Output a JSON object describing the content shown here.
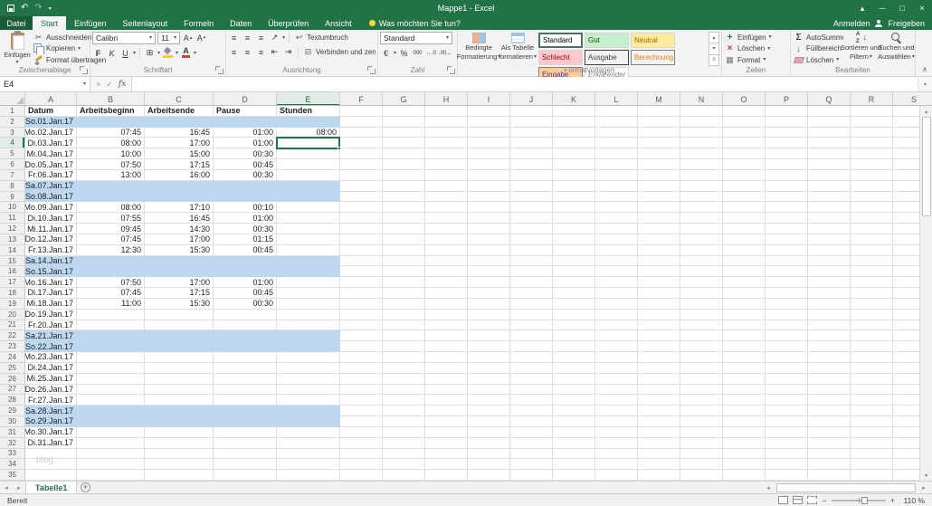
{
  "window": {
    "title": "Mappe1 - Excel",
    "sign_in": "Anmelden",
    "share": "Freigeben"
  },
  "tabs": {
    "file": "Datei",
    "active": "Start",
    "items": [
      "Start",
      "Einfügen",
      "Seitenlayout",
      "Formeln",
      "Daten",
      "Überprüfen",
      "Ansicht"
    ],
    "tell_me": "Was möchten Sie tun?"
  },
  "ribbon": {
    "clipboard": {
      "title": "Zwischenablage",
      "paste": "Einfügen",
      "cut": "Ausschneiden",
      "copy": "Kopieren",
      "format_painter": "Format übertragen"
    },
    "font": {
      "title": "Schriftart",
      "name": "Calibri",
      "size": "11",
      "bold": "F",
      "italic": "K",
      "underline": "U"
    },
    "alignment": {
      "title": "Ausrichtung",
      "wrap": "Textumbruch",
      "merge": "Verbinden und zentrieren"
    },
    "number": {
      "title": "Zahl",
      "format": "Standard"
    },
    "styles": {
      "title": "Formatvorlagen",
      "conditional": [
        "Bedingte",
        "Formatierung"
      ],
      "as_table": [
        "Als Tabelle",
        "formatieren"
      ],
      "gallery": [
        {
          "label": "Standard",
          "bg": "#ffffff",
          "color": "#000000",
          "selected": true
        },
        {
          "label": "Gut",
          "bg": "#c6efce",
          "color": "#006100"
        },
        {
          "label": "Neutral",
          "bg": "#ffeb9c",
          "color": "#9c6500"
        },
        {
          "label": "Schlecht",
          "bg": "#ffc7ce",
          "color": "#9c0006"
        },
        {
          "label": "Ausgabe",
          "bg": "#f2f2f2",
          "color": "#3f3f3f",
          "border": "#3f3f3f"
        },
        {
          "label": "Berechnung",
          "bg": "#f2f2f2",
          "color": "#fa7d00",
          "border": "#7f7f7f"
        },
        {
          "label": "Eingabe",
          "bg": "#ffcc99",
          "color": "#3f3f76",
          "border": "#7f7f7f"
        },
        {
          "label": "Erklärender ...",
          "bg": "#ffffff",
          "color": "#7f7f7f",
          "italic": true
        }
      ]
    },
    "cells": {
      "title": "Zellen",
      "insert": "Einfügen",
      "delete": "Löschen",
      "format": "Format"
    },
    "editing": {
      "title": "Bearbeiten",
      "autosum": "AutoSumme",
      "fill": "Füllbereich",
      "clear": "Löschen",
      "sort": [
        "Sortieren und",
        "Filtern"
      ],
      "find": [
        "Suchen und",
        "Auswählen"
      ]
    }
  },
  "formula_bar": {
    "name_box": "E4",
    "formula": ""
  },
  "sheet": {
    "columns": [
      "A",
      "B",
      "C",
      "D",
      "E",
      "F",
      "G",
      "H",
      "I",
      "J",
      "K",
      "L",
      "M",
      "N",
      "O",
      "P",
      "Q",
      "R",
      "S"
    ],
    "visible_rows": 35,
    "selected": {
      "col": "E",
      "row": 4
    },
    "header_row": [
      "Datum",
      "Arbeitsbeginn",
      "Arbeitsende",
      "Pause",
      "Stunden"
    ],
    "weekend_fill": "#bdd7ee",
    "rows": [
      {
        "n": 2,
        "a": "So.01.Jan.17",
        "we": true
      },
      {
        "n": 3,
        "a": "Mo.02.Jan.17",
        "b": "07:45",
        "c": "16:45",
        "d": "01:00",
        "e": "08:00"
      },
      {
        "n": 4,
        "a": "Di.03.Jan.17",
        "b": "08:00",
        "c": "17:00",
        "d": "01:00"
      },
      {
        "n": 5,
        "a": "Mi.04.Jan.17",
        "b": "10:00",
        "c": "15:00",
        "d": "00:30"
      },
      {
        "n": 6,
        "a": "Do.05.Jan.17",
        "b": "07:50",
        "c": "17:15",
        "d": "00:45"
      },
      {
        "n": 7,
        "a": "Fr.06.Jan.17",
        "b": "13:00",
        "c": "16:00",
        "d": "00:30"
      },
      {
        "n": 8,
        "a": "Sa.07.Jan.17",
        "we": true
      },
      {
        "n": 9,
        "a": "So.08.Jan.17",
        "we": true
      },
      {
        "n": 10,
        "a": "Mo.09.Jan.17",
        "b": "08:00",
        "c": "17:10",
        "d": "00:10"
      },
      {
        "n": 11,
        "a": "Di.10.Jan.17",
        "b": "07:55",
        "c": "16:45",
        "d": "01:00"
      },
      {
        "n": 12,
        "a": "Mi.11.Jan.17",
        "b": "09:45",
        "c": "14:30",
        "d": "00:30"
      },
      {
        "n": 13,
        "a": "Do.12.Jan.17",
        "b": "07:45",
        "c": "17:00",
        "d": "01:15"
      },
      {
        "n": 14,
        "a": "Fr.13.Jan.17",
        "b": "12:30",
        "c": "15:30",
        "d": "00:45"
      },
      {
        "n": 15,
        "a": "Sa.14.Jan.17",
        "we": true
      },
      {
        "n": 16,
        "a": "So.15.Jan.17",
        "we": true
      },
      {
        "n": 17,
        "a": "Mo.16.Jan.17",
        "b": "07:50",
        "c": "17:00",
        "d": "01:00"
      },
      {
        "n": 18,
        "a": "Di.17.Jan.17",
        "b": "07:45",
        "c": "17:15",
        "d": "00:45"
      },
      {
        "n": 19,
        "a": "Mi.18.Jan.17",
        "b": "11:00",
        "c": "15:30",
        "d": "00:30"
      },
      {
        "n": 20,
        "a": "Do.19.Jan.17"
      },
      {
        "n": 21,
        "a": "Fr.20.Jan.17"
      },
      {
        "n": 22,
        "a": "Sa.21.Jan.17",
        "we": true
      },
      {
        "n": 23,
        "a": "So.22.Jan.17",
        "we": true
      },
      {
        "n": 24,
        "a": "Mo.23.Jan.17"
      },
      {
        "n": 25,
        "a": "Di.24.Jan.17"
      },
      {
        "n": 26,
        "a": "Mi.25.Jan.17"
      },
      {
        "n": 27,
        "a": "Do.26.Jan.17"
      },
      {
        "n": 28,
        "a": "Fr.27.Jan.17"
      },
      {
        "n": 29,
        "a": "Sa.28.Jan.17",
        "we": true
      },
      {
        "n": 30,
        "a": "So.29.Jan.17",
        "we": true
      },
      {
        "n": 31,
        "a": "Mo.30.Jan.17"
      },
      {
        "n": 32,
        "a": "Di.31.Jan.17"
      }
    ],
    "watermark": "blog"
  },
  "sheet_tabs": {
    "active": "Tabelle1"
  },
  "status_bar": {
    "status": "Bereit",
    "zoom": "110 %"
  }
}
